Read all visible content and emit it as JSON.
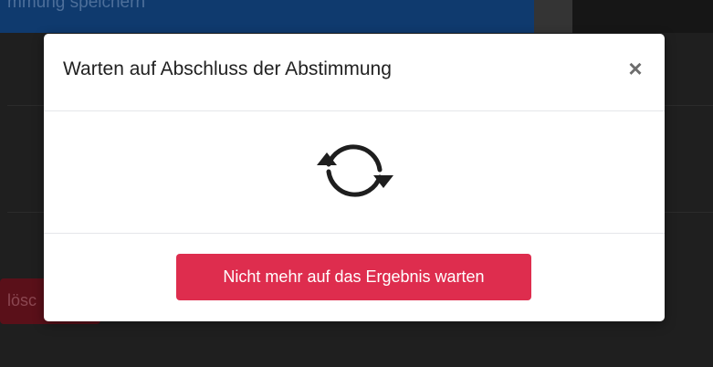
{
  "background": {
    "topbar_text": "mmung speichern",
    "danger_button_text": "lösc"
  },
  "modal": {
    "title": "Warten auf Abschluss der Abstimmung",
    "close_glyph": "×",
    "icon": "sync-icon",
    "primary_button_label": "Nicht mehr auf das Ergebnis warten"
  },
  "colors": {
    "button_danger": "#de2d4e",
    "modal_bg": "#ffffff",
    "page_bg": "#1f1f1f",
    "topbar": "#0f3a6e"
  }
}
